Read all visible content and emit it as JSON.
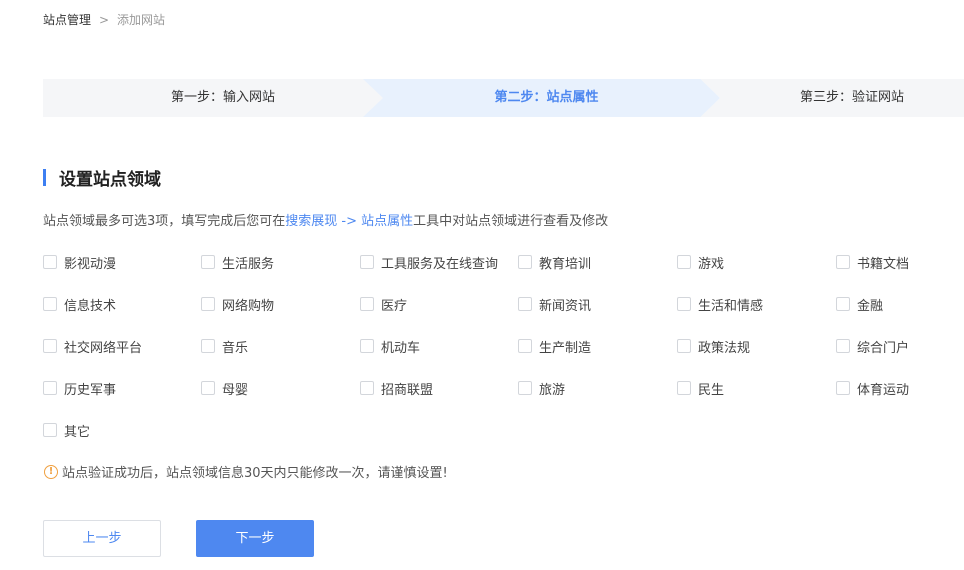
{
  "breadcrumb": {
    "root": "站点管理",
    "separator": ">",
    "current": "添加网站"
  },
  "steps": [
    {
      "label": "第一步：输入网站",
      "active": false
    },
    {
      "label": "第二步：站点属性",
      "active": true
    },
    {
      "label": "第三步：验证网站",
      "active": false
    }
  ],
  "section": {
    "title": "设置站点领域"
  },
  "description": {
    "prefix": "站点领域最多可选3项，填写完成后您可在",
    "link": "搜索展现 -> 站点属性",
    "suffix": "工具中对站点领域进行查看及修改"
  },
  "domains": [
    "影视动漫",
    "生活服务",
    "工具服务及在线查询",
    "教育培训",
    "游戏",
    "书籍文档",
    "信息技术",
    "网络购物",
    "医疗",
    "新闻资讯",
    "生活和情感",
    "金融",
    "社交网络平台",
    "音乐",
    "机动车",
    "生产制造",
    "政策法规",
    "综合门户",
    "历史军事",
    "母婴",
    "招商联盟",
    "旅游",
    "民生",
    "体育运动",
    "其它"
  ],
  "warning": {
    "icon": "!",
    "text": "站点验证成功后，站点领域信息30天内只能修改一次，请谨慎设置!"
  },
  "buttons": {
    "prev": "上一步",
    "next": "下一步"
  },
  "colors": {
    "accent": "#4e88f0",
    "active_step_bg": "#e8f1fd",
    "step_bg": "#f5f6f8",
    "warning": "#f0a040"
  }
}
